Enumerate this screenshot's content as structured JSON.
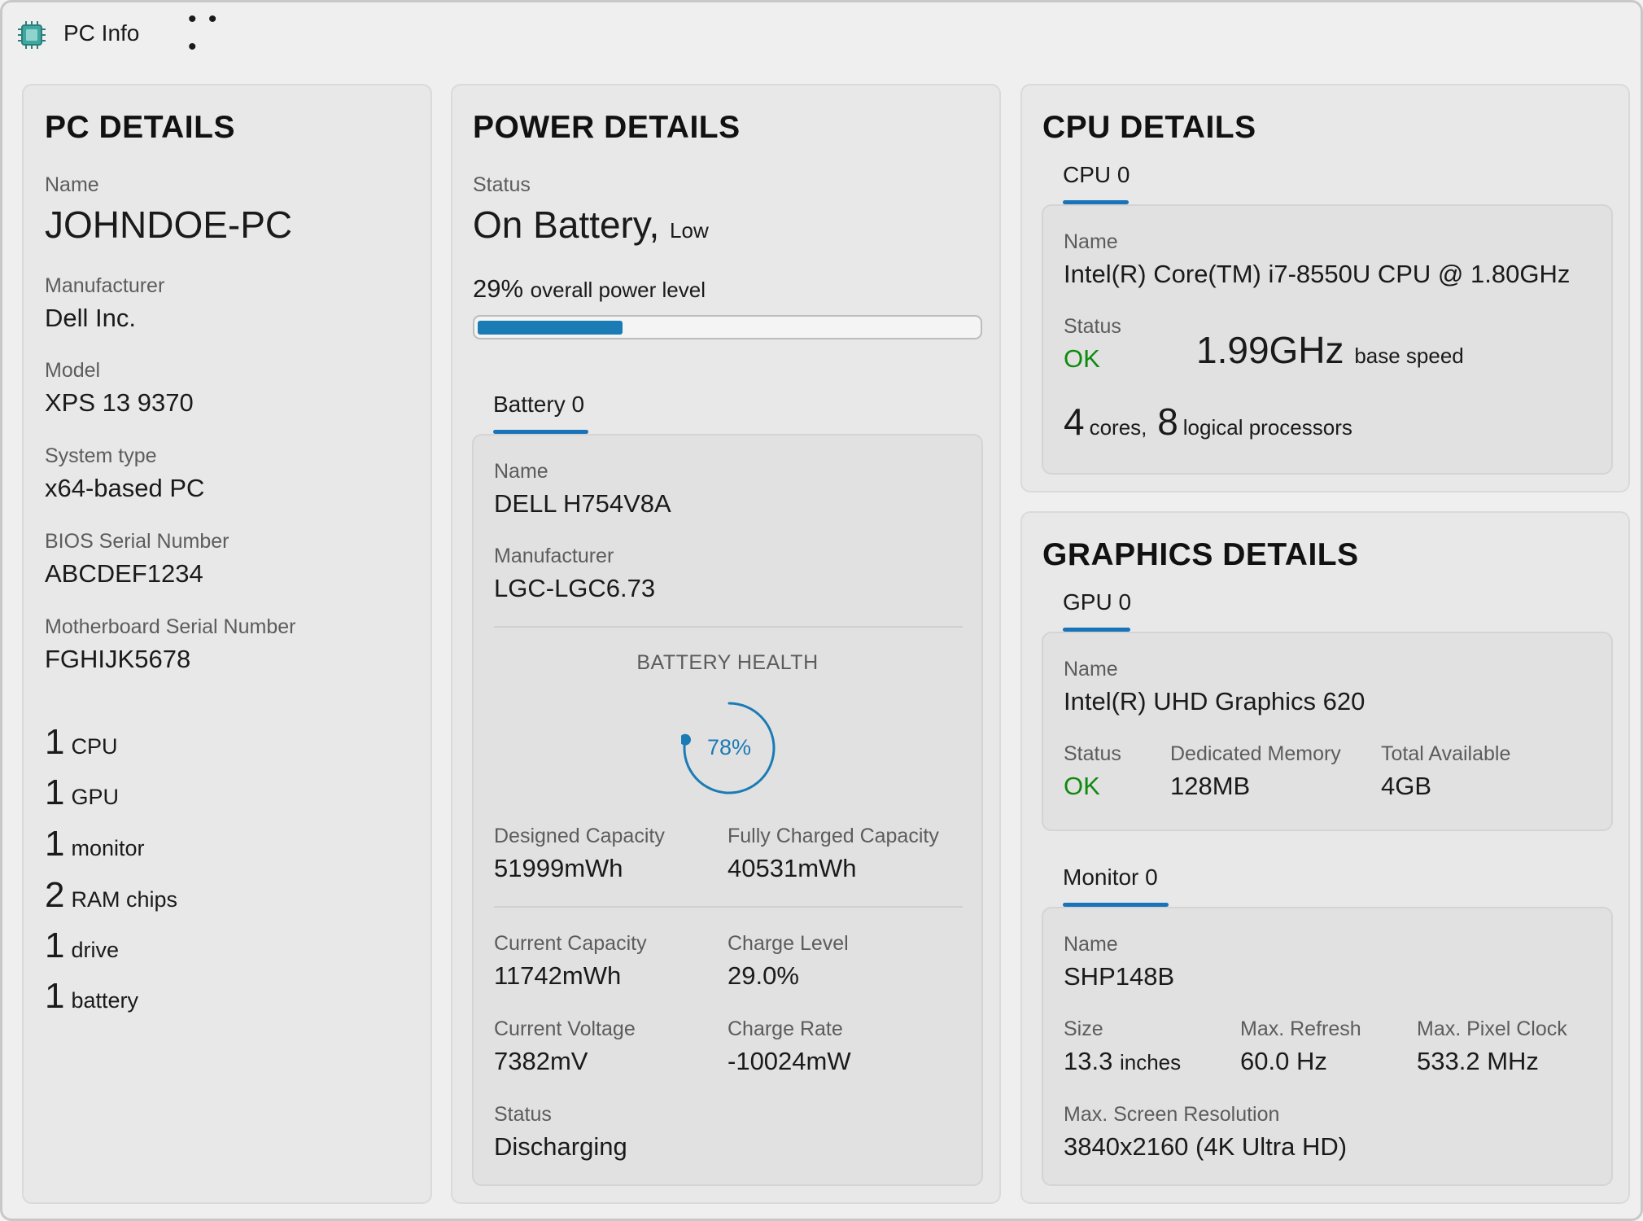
{
  "app": {
    "title": "PC Info",
    "more_label": "• • •",
    "icon": "chip-icon"
  },
  "colors": {
    "accent": "#1873b9",
    "ok": "#0f8a0f",
    "card_bg": "#e8e8e8"
  },
  "pc": {
    "heading": "PC DETAILS",
    "name_label": "Name",
    "name": "JOHNDOE-PC",
    "manufacturer_label": "Manufacturer",
    "manufacturer": "Dell Inc.",
    "model_label": "Model",
    "model": "XPS 13 9370",
    "system_type_label": "System type",
    "system_type": "x64-based PC",
    "bios_label": "BIOS Serial Number",
    "bios": "ABCDEF1234",
    "mobo_label": "Motherboard Serial Number",
    "mobo": "FGHIJK5678",
    "counts": [
      {
        "n": "1",
        "t": "CPU"
      },
      {
        "n": "1",
        "t": "GPU"
      },
      {
        "n": "1",
        "t": "monitor"
      },
      {
        "n": "2",
        "t": "RAM chips"
      },
      {
        "n": "1",
        "t": "drive"
      },
      {
        "n": "1",
        "t": "battery"
      }
    ]
  },
  "power": {
    "heading": "POWER DETAILS",
    "status_label": "Status",
    "status": "On Battery,",
    "status_sub": "Low",
    "level_pct_text": "29%",
    "level_text": "overall power level",
    "level": 0.29,
    "battery_tab": "Battery 0",
    "battery": {
      "name_label": "Name",
      "name": "DELL H754V8A",
      "manufacturer_label": "Manufacturer",
      "manufacturer": "LGC-LGC6.73",
      "health_label": "BATTERY HEALTH",
      "health_text": "78%",
      "health": 0.78,
      "designed_label": "Designed Capacity",
      "designed": "51999mWh",
      "full_label": "Fully Charged Capacity",
      "full": "40531mWh",
      "current_label": "Current Capacity",
      "current": "11742mWh",
      "charge_level_label": "Charge Level",
      "charge_level": "29.0%",
      "voltage_label": "Current Voltage",
      "voltage": "7382mV",
      "rate_label": "Charge Rate",
      "rate": "-10024mW",
      "status_label": "Status",
      "status": "Discharging"
    }
  },
  "cpu": {
    "heading": "CPU DETAILS",
    "tab": "CPU 0",
    "name_label": "Name",
    "name": "Intel(R) Core(TM) i7-8550U CPU @ 1.80GHz",
    "status_label": "Status",
    "status": "OK",
    "speed": "1.99GHz",
    "speed_sub": "base speed",
    "cores": "4",
    "cores_text": "cores,",
    "logical": "8",
    "logical_text": "logical processors"
  },
  "graphics": {
    "heading": "GRAPHICS DETAILS",
    "tab": "GPU 0",
    "name_label": "Name",
    "name": "Intel(R) UHD Graphics 620",
    "status_label": "Status",
    "status": "OK",
    "dedicated_label": "Dedicated Memory",
    "dedicated": "128MB",
    "total_label": "Total Available",
    "total": "4GB",
    "monitor_tab": "Monitor 0",
    "monitor": {
      "name_label": "Name",
      "name": "SHP148B",
      "size_label": "Size",
      "size": "13.3",
      "size_unit": "inches",
      "refresh_label": "Max. Refresh",
      "refresh": "60.0 Hz",
      "clock_label": "Max. Pixel Clock",
      "clock": "533.2 MHz",
      "resolution_label": "Max. Screen Resolution",
      "resolution": "3840x2160 (4K Ultra HD)"
    }
  }
}
